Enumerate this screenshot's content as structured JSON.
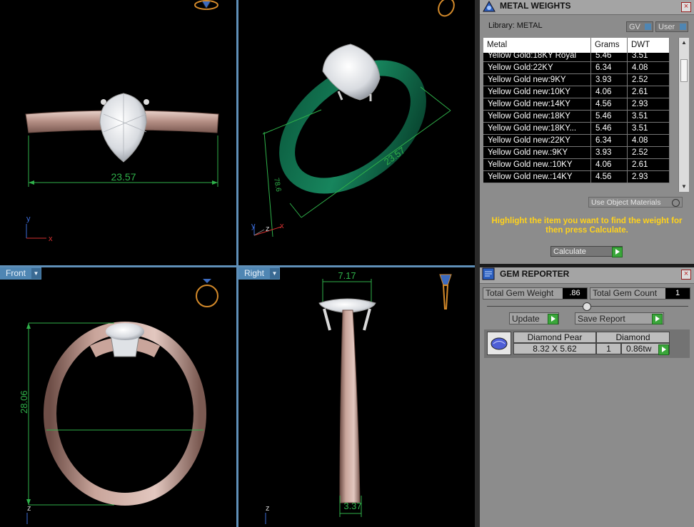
{
  "viewports": {
    "top": {
      "dimension": "23.57"
    },
    "perspective": {
      "dimension_long": "23.57",
      "dimension_side": "78.6"
    },
    "front": {
      "label": "Front",
      "dimension": "28.06"
    },
    "right": {
      "label": "Right",
      "dimension_top": "7.17",
      "dimension_bottom": "3.37"
    },
    "axes": {
      "x": "x",
      "y": "y",
      "z": "z"
    }
  },
  "metal_weights": {
    "title": "METAL WEIGHTS",
    "library": "Library: METAL",
    "gv_label": "GV",
    "user_label": "User",
    "columns": [
      "Metal",
      "Grams",
      "DWT"
    ],
    "rows": [
      [
        "Yellow Gold:18KY Royal",
        "5.46",
        "3.51"
      ],
      [
        "Yellow Gold:22KY",
        "6.34",
        "4.08"
      ],
      [
        "Yellow Gold new:9KY",
        "3.93",
        "2.52"
      ],
      [
        "Yellow Gold new:10KY",
        "4.06",
        "2.61"
      ],
      [
        "Yellow Gold new:14KY",
        "4.56",
        "2.93"
      ],
      [
        "Yellow Gold new:18KY",
        "5.46",
        "3.51"
      ],
      [
        "Yellow Gold new:18KY...",
        "5.46",
        "3.51"
      ],
      [
        "Yellow Gold new:22KY",
        "6.34",
        "4.08"
      ],
      [
        "Yellow Gold new.:9KY",
        "3.93",
        "2.52"
      ],
      [
        "Yellow Gold new.:10KY",
        "4.06",
        "2.61"
      ],
      [
        "Yellow Gold new.:14KY",
        "4.56",
        "2.93"
      ]
    ],
    "use_object_materials": "Use Object Materials",
    "hint": "Highlight the item you want to find the weight for then press Calculate.",
    "calculate": "Calculate"
  },
  "gem_reporter": {
    "title": "GEM REPORTER",
    "total_weight_label": "Total Gem Weight",
    "total_weight_value": ".86",
    "total_count_label": "Total Gem Count",
    "total_count_value": "1",
    "update": "Update",
    "save_report": "Save Report",
    "gem": {
      "name": "Diamond Pear",
      "size": "8.32 X 5.62",
      "material": "Diamond",
      "count": "1",
      "weight": "0.86tw"
    }
  },
  "colors": {
    "accent": "#4f86b3",
    "band": "#c7a49a",
    "green_band": "#0e6b4c",
    "dimension": "#2fb14a",
    "hint": "#ffd21c"
  }
}
